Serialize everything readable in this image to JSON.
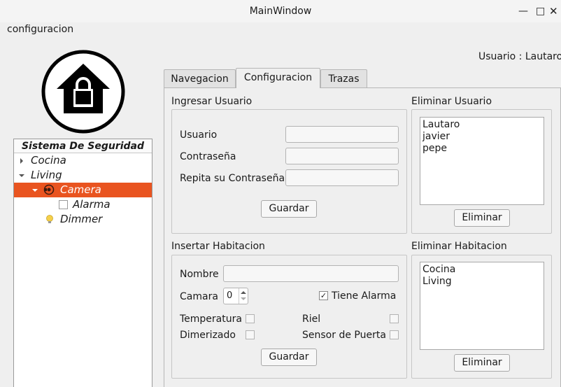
{
  "window": {
    "title": "MainWindow"
  },
  "menubar": {
    "items": [
      "configuracion"
    ]
  },
  "user": {
    "label": "Usuario : Lautaro"
  },
  "tree": {
    "header": "Sistema De Seguridad",
    "items": [
      {
        "label": "Cocina"
      },
      {
        "label": "Living"
      },
      {
        "label": "Camera",
        "selected": true
      },
      {
        "label": "Alarma"
      },
      {
        "label": "Dimmer"
      }
    ]
  },
  "tabs": [
    {
      "label": "Navegacion"
    },
    {
      "label": "Configuracion",
      "active": true
    },
    {
      "label": "Trazas"
    }
  ],
  "ingresar_usuario": {
    "title": "Ingresar Usuario",
    "usuario_label": "Usuario",
    "contrasena_label": "Contraseña",
    "repita_label": "Repita su Contraseña",
    "guardar": "Guardar"
  },
  "eliminar_usuario": {
    "title": "Eliminar Usuario",
    "users": [
      "Lautaro",
      "javier",
      "pepe"
    ],
    "eliminar": "Eliminar"
  },
  "insertar_habitacion": {
    "title": "Insertar Habitacion",
    "nombre_label": "Nombre",
    "camara_label": "Camara",
    "camara_value": "0",
    "tiene_alarma_label": "Tiene Alarma",
    "tiene_alarma_checked": true,
    "temperatura_label": "Temperatura",
    "riel_label": "Riel",
    "dimerizado_label": "Dimerizado",
    "sensor_puerta_label": "Sensor de Puerta",
    "guardar": "Guardar"
  },
  "eliminar_habitacion": {
    "title": "Eliminar Habitacion",
    "rooms": [
      "Cocina",
      "Living"
    ],
    "eliminar": "Eliminar"
  },
  "colors": {
    "accent": "#e95420"
  }
}
